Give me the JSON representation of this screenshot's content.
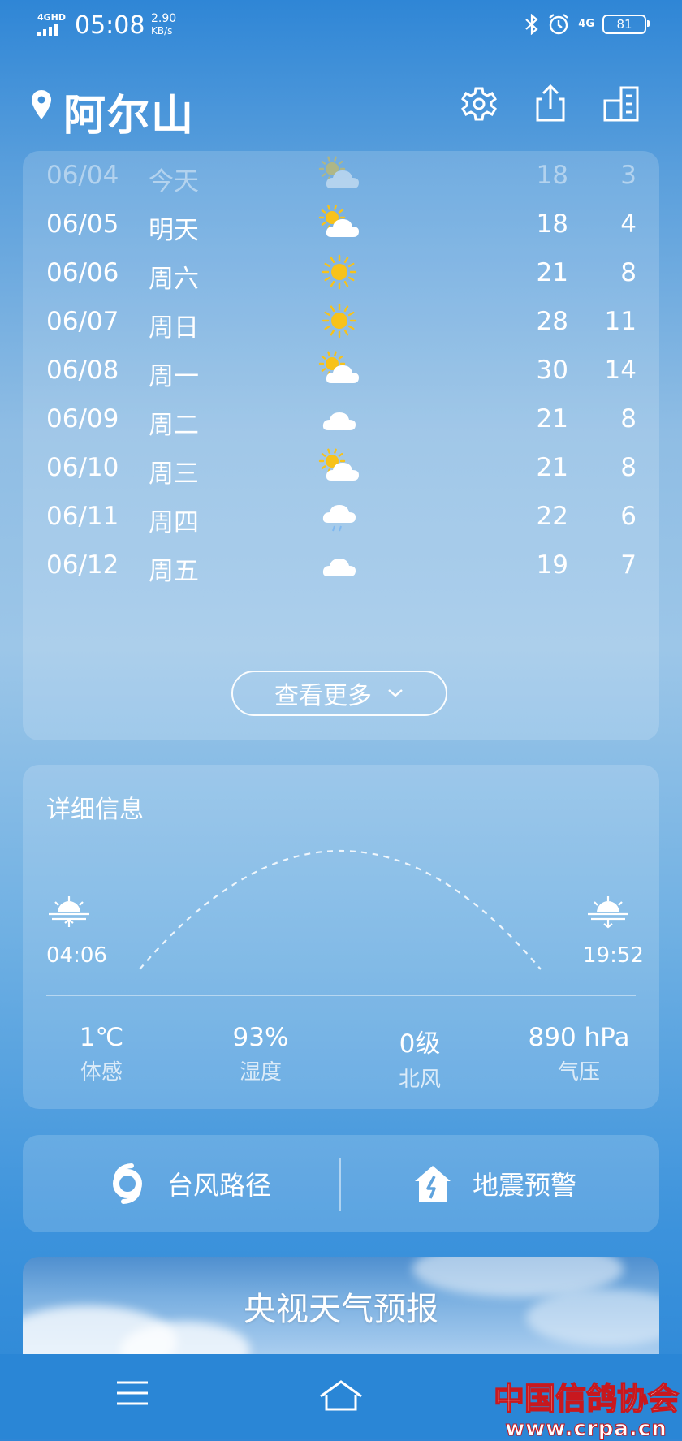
{
  "status_bar": {
    "network": "4GHD",
    "time": "05:08",
    "speed_value": "2.90",
    "speed_unit": "KB/s",
    "net_right": "4G",
    "battery": "81"
  },
  "header": {
    "city": "阿尔山",
    "icons": [
      "location-pin-icon",
      "gear-icon",
      "share-icon",
      "city-list-icon"
    ]
  },
  "forecast": {
    "rows": [
      {
        "date": "06/04",
        "day": "今天",
        "icon": "partly-cloudy",
        "high": "18",
        "low": "3"
      },
      {
        "date": "06/05",
        "day": "明天",
        "icon": "partly-cloudy",
        "high": "18",
        "low": "4"
      },
      {
        "date": "06/06",
        "day": "周六",
        "icon": "sunny",
        "high": "21",
        "low": "8"
      },
      {
        "date": "06/07",
        "day": "周日",
        "icon": "sunny",
        "high": "28",
        "low": "11"
      },
      {
        "date": "06/08",
        "day": "周一",
        "icon": "partly-cloudy",
        "high": "30",
        "low": "14"
      },
      {
        "date": "06/09",
        "day": "周二",
        "icon": "cloudy",
        "high": "21",
        "low": "8"
      },
      {
        "date": "06/10",
        "day": "周三",
        "icon": "partly-cloudy",
        "high": "21",
        "low": "8"
      },
      {
        "date": "06/11",
        "day": "周四",
        "icon": "light-rain",
        "high": "22",
        "low": "6"
      },
      {
        "date": "06/12",
        "day": "周五",
        "icon": "cloudy",
        "high": "19",
        "low": "7"
      }
    ],
    "more_label": "查看更多"
  },
  "detail": {
    "title": "详细信息",
    "sunrise": "04:06",
    "sunset": "19:52",
    "stats": [
      {
        "value": "1℃",
        "label": "体感"
      },
      {
        "value": "93%",
        "label": "湿度"
      },
      {
        "value": "0级",
        "label": "北风"
      },
      {
        "value": "890 hPa",
        "label": "气压"
      }
    ]
  },
  "quick": {
    "typhoon_label": "台风路径",
    "earthquake_label": "地震预警"
  },
  "banner": {
    "title": "央视天气预报"
  },
  "watermark": {
    "line1": "中国信鸽协会",
    "line2": "www.crpa.cn"
  },
  "colors": {
    "sun": "#f7c21b",
    "cloud": "#ffffff",
    "watermark_red": "#c8181e"
  }
}
